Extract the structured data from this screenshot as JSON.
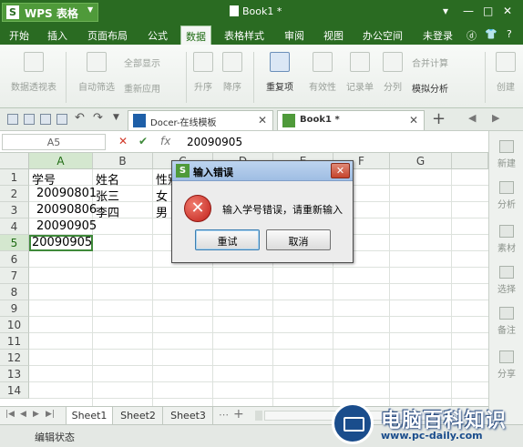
{
  "app": {
    "menu_button": "WPS 表格",
    "window_title": "Book1 *",
    "controls": [
      "▾",
      "—",
      "□",
      "✕"
    ]
  },
  "menu": {
    "items": [
      "开始",
      "插入",
      "页面布局",
      "公式",
      "数据",
      "表格样式",
      "审阅",
      "视图",
      "办公空间"
    ],
    "active": "数据",
    "login": "未登录",
    "help": "?"
  },
  "ribbon": {
    "pivot": "数据透视表",
    "autofilter": "自动筛选",
    "show_all": "全部显示",
    "reapply": "重新应用",
    "sort_asc": "升序",
    "sort_desc": "降序",
    "duplicates": "重复项",
    "validity": "有效性",
    "record_form": "记录单",
    "split": "分列",
    "merge_calc": "合并计算",
    "what_if": "模拟分析",
    "create": "创建"
  },
  "doc_tabs": {
    "docer": "Docer-在线模板",
    "book": "Book1 *"
  },
  "formula_bar": {
    "name_box": "A5",
    "value": "20090905"
  },
  "sheet": {
    "columns": [
      "A",
      "B",
      "C",
      "D",
      "E",
      "F",
      "G"
    ],
    "rows": [
      "1",
      "2",
      "3",
      "4",
      "5",
      "6",
      "7",
      "8",
      "9",
      "10",
      "11",
      "12",
      "13",
      "14"
    ],
    "cells": {
      "r1": [
        "学号",
        "姓名",
        "性别"
      ],
      "r2": [
        "20090801",
        "张三",
        "女"
      ],
      "r3": [
        "20090806",
        "李四",
        "男"
      ],
      "r4": [
        "20090905"
      ],
      "r5": [
        "20090905"
      ]
    }
  },
  "sheet_tabs": [
    "Sheet1",
    "Sheet2",
    "Sheet3"
  ],
  "status": "编辑状态",
  "side_panel": [
    "新建",
    "分析",
    "素材",
    "选择",
    "备注",
    "分享"
  ],
  "dialog": {
    "title": "输入错误",
    "message": "输入学号错误，请重新输入",
    "retry": "重试",
    "cancel": "取消"
  },
  "watermark": {
    "brand": "电脑百科知识",
    "url": "www.pc-daily.com"
  },
  "colors": {
    "wps_green": "#2a6b22",
    "active_cell_border": "#3f8a3a",
    "error_red": "#c1201a",
    "watermark_blue": "#1a4d8c"
  }
}
